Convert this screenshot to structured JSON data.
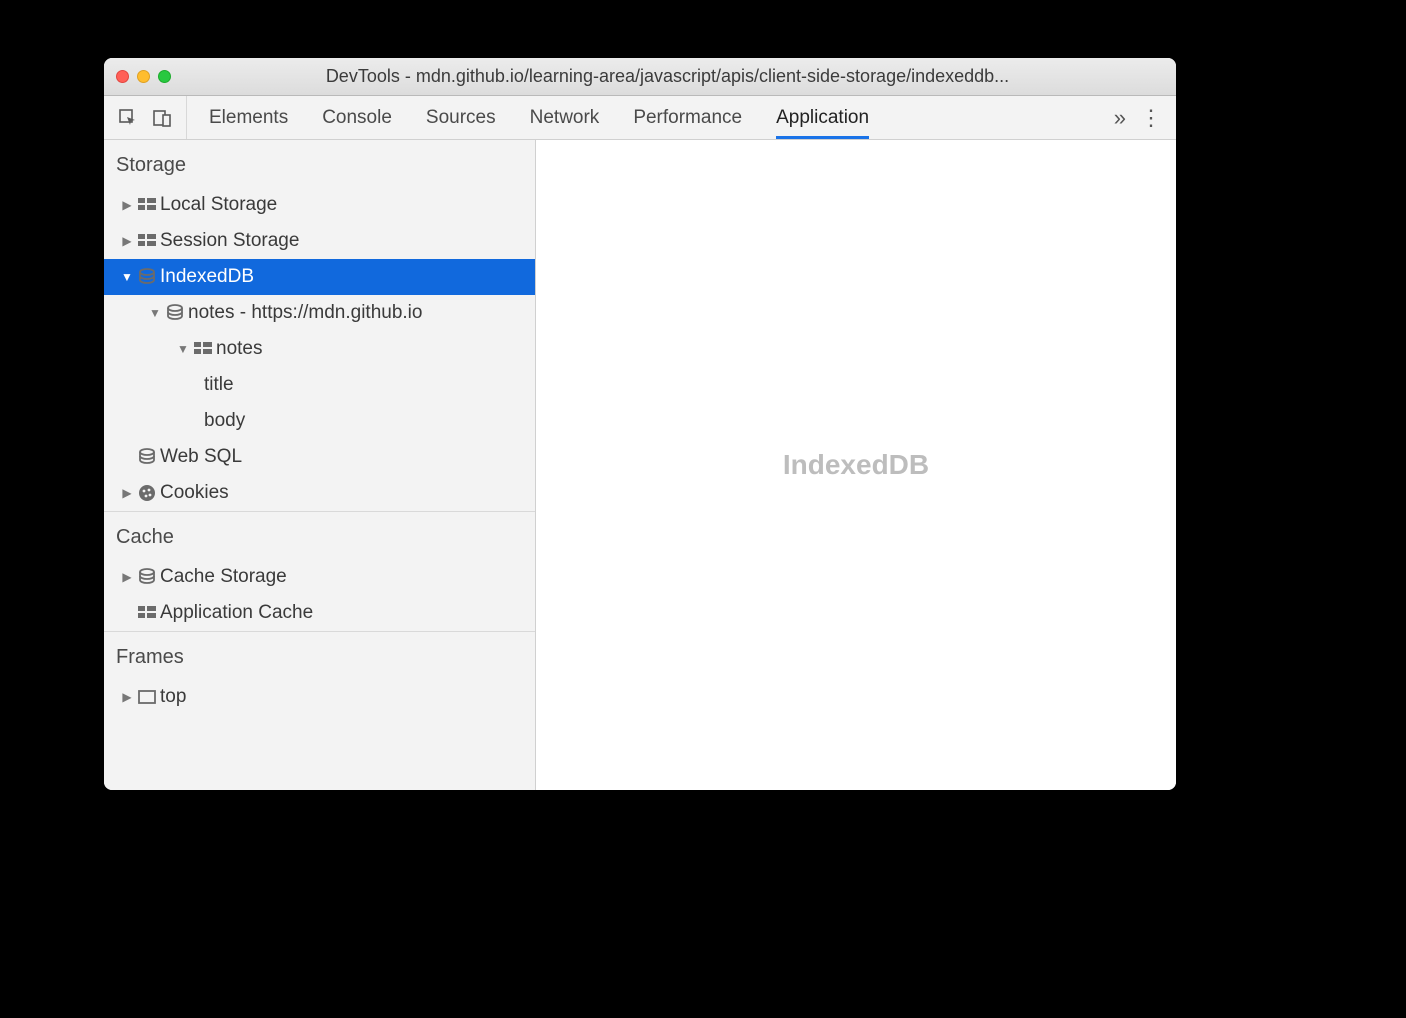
{
  "window": {
    "title": "DevTools - mdn.github.io/learning-area/javascript/apis/client-side-storage/indexeddb..."
  },
  "tabs": {
    "items": [
      "Elements",
      "Console",
      "Sources",
      "Network",
      "Performance",
      "Application"
    ],
    "active": "Application",
    "overflow": "»"
  },
  "sidebar": {
    "sections": {
      "storage": {
        "label": "Storage",
        "local_storage": "Local Storage",
        "session_storage": "Session Storage",
        "indexeddb": "IndexedDB",
        "indexeddb_db": "notes - https://mdn.github.io",
        "indexeddb_store": "notes",
        "indexeddb_index_title": "title",
        "indexeddb_index_body": "body",
        "web_sql": "Web SQL",
        "cookies": "Cookies"
      },
      "cache": {
        "label": "Cache",
        "cache_storage": "Cache Storage",
        "application_cache": "Application Cache"
      },
      "frames": {
        "label": "Frames",
        "top": "top"
      }
    }
  },
  "content": {
    "placeholder": "IndexedDB"
  }
}
